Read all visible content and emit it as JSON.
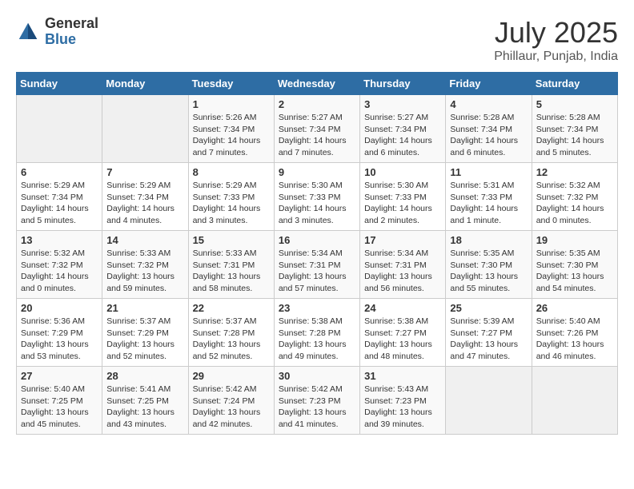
{
  "logo": {
    "general": "General",
    "blue": "Blue"
  },
  "title": {
    "month_year": "July 2025",
    "location": "Phillaur, Punjab, India"
  },
  "days_of_week": [
    "Sunday",
    "Monday",
    "Tuesday",
    "Wednesday",
    "Thursday",
    "Friday",
    "Saturday"
  ],
  "weeks": [
    [
      {
        "day": "",
        "content": ""
      },
      {
        "day": "",
        "content": ""
      },
      {
        "day": "1",
        "content": "Sunrise: 5:26 AM\nSunset: 7:34 PM\nDaylight: 14 hours and 7 minutes."
      },
      {
        "day": "2",
        "content": "Sunrise: 5:27 AM\nSunset: 7:34 PM\nDaylight: 14 hours and 7 minutes."
      },
      {
        "day": "3",
        "content": "Sunrise: 5:27 AM\nSunset: 7:34 PM\nDaylight: 14 hours and 6 minutes."
      },
      {
        "day": "4",
        "content": "Sunrise: 5:28 AM\nSunset: 7:34 PM\nDaylight: 14 hours and 6 minutes."
      },
      {
        "day": "5",
        "content": "Sunrise: 5:28 AM\nSunset: 7:34 PM\nDaylight: 14 hours and 5 minutes."
      }
    ],
    [
      {
        "day": "6",
        "content": "Sunrise: 5:29 AM\nSunset: 7:34 PM\nDaylight: 14 hours and 5 minutes."
      },
      {
        "day": "7",
        "content": "Sunrise: 5:29 AM\nSunset: 7:34 PM\nDaylight: 14 hours and 4 minutes."
      },
      {
        "day": "8",
        "content": "Sunrise: 5:29 AM\nSunset: 7:33 PM\nDaylight: 14 hours and 3 minutes."
      },
      {
        "day": "9",
        "content": "Sunrise: 5:30 AM\nSunset: 7:33 PM\nDaylight: 14 hours and 3 minutes."
      },
      {
        "day": "10",
        "content": "Sunrise: 5:30 AM\nSunset: 7:33 PM\nDaylight: 14 hours and 2 minutes."
      },
      {
        "day": "11",
        "content": "Sunrise: 5:31 AM\nSunset: 7:33 PM\nDaylight: 14 hours and 1 minute."
      },
      {
        "day": "12",
        "content": "Sunrise: 5:32 AM\nSunset: 7:32 PM\nDaylight: 14 hours and 0 minutes."
      }
    ],
    [
      {
        "day": "13",
        "content": "Sunrise: 5:32 AM\nSunset: 7:32 PM\nDaylight: 14 hours and 0 minutes."
      },
      {
        "day": "14",
        "content": "Sunrise: 5:33 AM\nSunset: 7:32 PM\nDaylight: 13 hours and 59 minutes."
      },
      {
        "day": "15",
        "content": "Sunrise: 5:33 AM\nSunset: 7:31 PM\nDaylight: 13 hours and 58 minutes."
      },
      {
        "day": "16",
        "content": "Sunrise: 5:34 AM\nSunset: 7:31 PM\nDaylight: 13 hours and 57 minutes."
      },
      {
        "day": "17",
        "content": "Sunrise: 5:34 AM\nSunset: 7:31 PM\nDaylight: 13 hours and 56 minutes."
      },
      {
        "day": "18",
        "content": "Sunrise: 5:35 AM\nSunset: 7:30 PM\nDaylight: 13 hours and 55 minutes."
      },
      {
        "day": "19",
        "content": "Sunrise: 5:35 AM\nSunset: 7:30 PM\nDaylight: 13 hours and 54 minutes."
      }
    ],
    [
      {
        "day": "20",
        "content": "Sunrise: 5:36 AM\nSunset: 7:29 PM\nDaylight: 13 hours and 53 minutes."
      },
      {
        "day": "21",
        "content": "Sunrise: 5:37 AM\nSunset: 7:29 PM\nDaylight: 13 hours and 52 minutes."
      },
      {
        "day": "22",
        "content": "Sunrise: 5:37 AM\nSunset: 7:28 PM\nDaylight: 13 hours and 52 minutes."
      },
      {
        "day": "23",
        "content": "Sunrise: 5:38 AM\nSunset: 7:28 PM\nDaylight: 13 hours and 49 minutes."
      },
      {
        "day": "24",
        "content": "Sunrise: 5:38 AM\nSunset: 7:27 PM\nDaylight: 13 hours and 48 minutes."
      },
      {
        "day": "25",
        "content": "Sunrise: 5:39 AM\nSunset: 7:27 PM\nDaylight: 13 hours and 47 minutes."
      },
      {
        "day": "26",
        "content": "Sunrise: 5:40 AM\nSunset: 7:26 PM\nDaylight: 13 hours and 46 minutes."
      }
    ],
    [
      {
        "day": "27",
        "content": "Sunrise: 5:40 AM\nSunset: 7:25 PM\nDaylight: 13 hours and 45 minutes."
      },
      {
        "day": "28",
        "content": "Sunrise: 5:41 AM\nSunset: 7:25 PM\nDaylight: 13 hours and 43 minutes."
      },
      {
        "day": "29",
        "content": "Sunrise: 5:42 AM\nSunset: 7:24 PM\nDaylight: 13 hours and 42 minutes."
      },
      {
        "day": "30",
        "content": "Sunrise: 5:42 AM\nSunset: 7:23 PM\nDaylight: 13 hours and 41 minutes."
      },
      {
        "day": "31",
        "content": "Sunrise: 5:43 AM\nSunset: 7:23 PM\nDaylight: 13 hours and 39 minutes."
      },
      {
        "day": "",
        "content": ""
      },
      {
        "day": "",
        "content": ""
      }
    ]
  ]
}
